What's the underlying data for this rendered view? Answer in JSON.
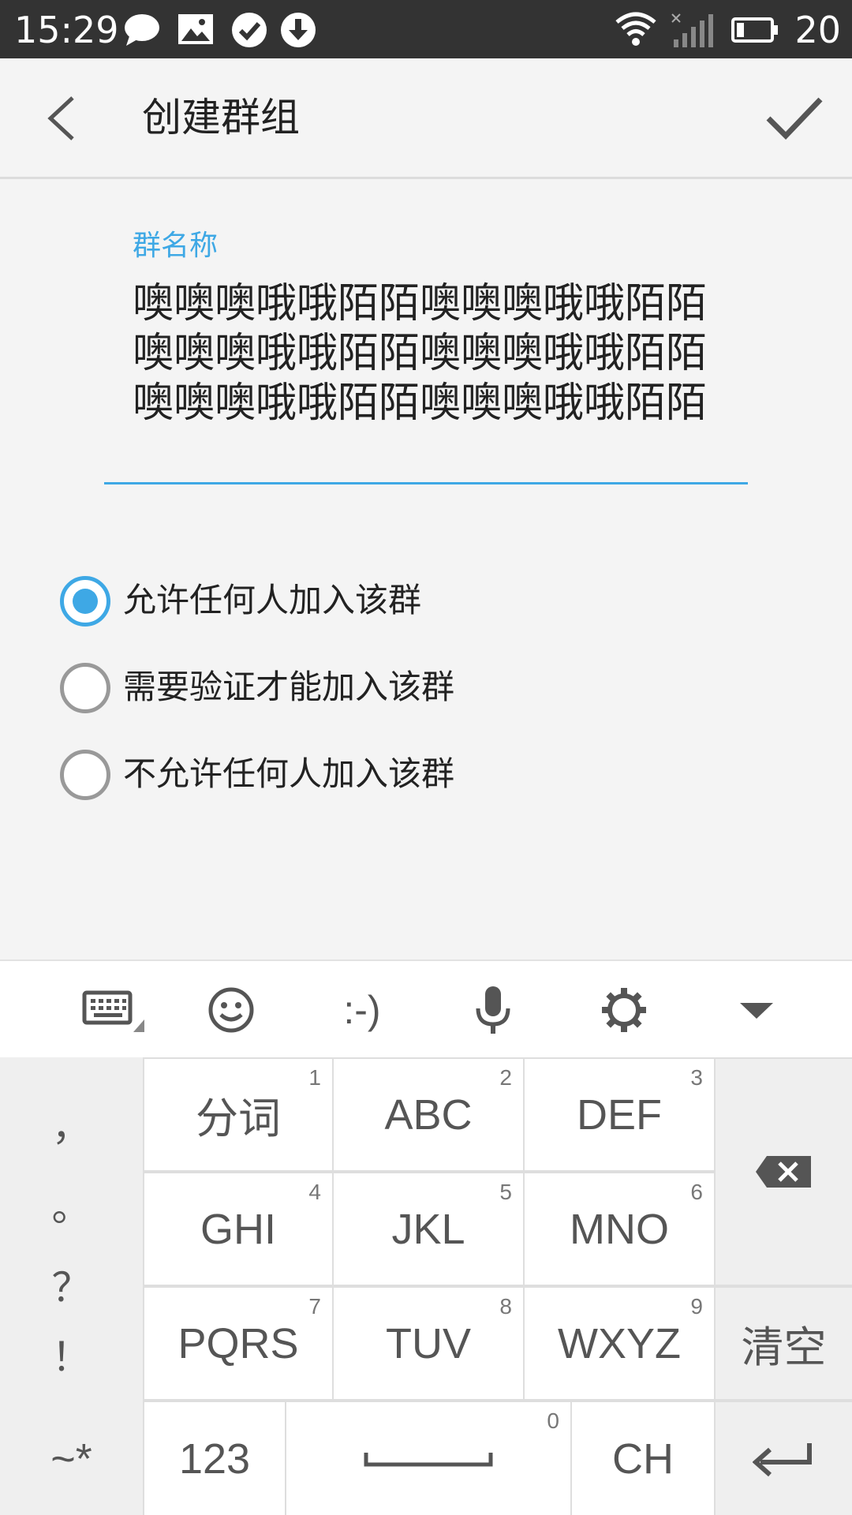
{
  "status_bar": {
    "time": "15:29",
    "battery": "20",
    "icons": [
      "chat-bubble-icon",
      "image-icon",
      "check-circle-icon",
      "download-icon",
      "wifi-icon",
      "signal-icon",
      "battery-icon"
    ]
  },
  "app_bar": {
    "title": "创建群组",
    "back_icon": "chevron-left-icon",
    "confirm_icon": "check-icon"
  },
  "form": {
    "name_label": "群名称",
    "name_value": "噢噢噢哦哦陌陌噢噢噢哦哦陌陌噢噢噢哦哦陌陌噢噢噢哦哦陌陌噢噢噢哦哦陌陌噢噢噢哦哦陌陌",
    "accent_color": "#3ea8e5"
  },
  "join_options": [
    {
      "label": "允许任何人加入该群",
      "selected": true
    },
    {
      "label": "需要验证才能加入该群",
      "selected": false
    },
    {
      "label": "不允许任何人加入该群",
      "selected": false
    }
  ],
  "keyboard": {
    "toolbar": [
      "keyboard-switch-icon",
      "emoji-icon",
      "emoticon-icon",
      "microphone-icon",
      "settings-gear-icon",
      "collapse-down-icon"
    ],
    "emoticon_text": ":-)",
    "punctuation": [
      "，",
      "。",
      "？",
      "！"
    ],
    "keys": [
      {
        "label": "分词",
        "num": "1"
      },
      {
        "label": "ABC",
        "num": "2"
      },
      {
        "label": "DEF",
        "num": "3"
      },
      {
        "label": "GHI",
        "num": "4"
      },
      {
        "label": "JKL",
        "num": "5"
      },
      {
        "label": "MNO",
        "num": "6"
      },
      {
        "label": "PQRS",
        "num": "7"
      },
      {
        "label": "TUV",
        "num": "8"
      },
      {
        "label": "WXYZ",
        "num": "9"
      }
    ],
    "clear_label": "清空",
    "symbols_label": "~*",
    "numbers_label": "123",
    "space_num": "0",
    "lang_label": "CH",
    "backspace_icon": "backspace-icon",
    "enter_icon": "enter-icon"
  }
}
